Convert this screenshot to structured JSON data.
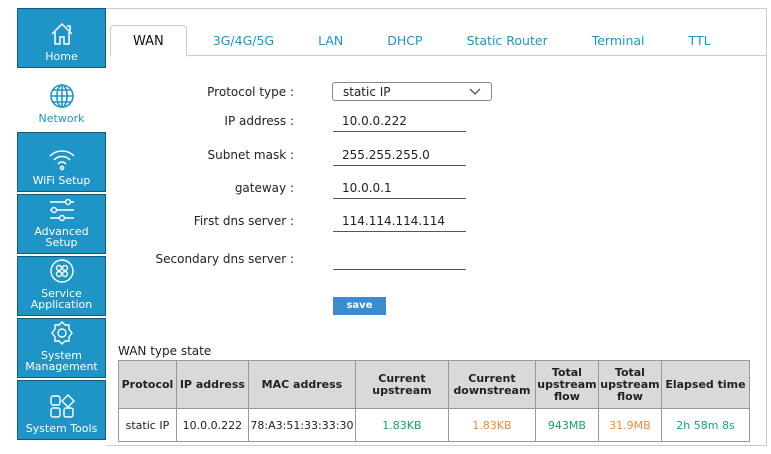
{
  "sidebar": {
    "items": [
      {
        "label": "Home",
        "icon": "home-icon"
      },
      {
        "label": "Network",
        "icon": "globe-icon",
        "active": true
      },
      {
        "label": "WiFi Setup",
        "icon": "wifi-icon"
      },
      {
        "label": "Advanced Setup",
        "icon": "sliders-icon"
      },
      {
        "label": "Service Application",
        "icon": "service-icon"
      },
      {
        "label": "System Management",
        "icon": "gear-icon"
      },
      {
        "label": "System Tools",
        "icon": "tools-grid-icon"
      }
    ]
  },
  "tabs": [
    "WAN",
    "3G/4G/5G",
    "LAN",
    "DHCP",
    "Static Router",
    "Terminal",
    "TTL"
  ],
  "form": {
    "protocol_label": "Protocol type :",
    "protocol_value": "static IP",
    "ip_label": "IP address :",
    "ip_value": "10.0.0.222",
    "mask_label": "Subnet mask :",
    "mask_value": "255.255.255.0",
    "gw_label": "gateway :",
    "gw_value": "10.0.0.1",
    "dns1_label": "First dns server  :",
    "dns1_value": "114.114.114.114",
    "dns2_label": "Secondary dns server  :",
    "dns2_value": "",
    "save": "save"
  },
  "state": {
    "title": "WAN type state",
    "headers": [
      "Protocol",
      "IP address",
      "MAC address",
      "Current upstream",
      "Current downstream",
      "Total upstream flow",
      "Total upstream flow",
      "Elapsed time"
    ],
    "row": [
      "static IP",
      "10.0.0.222",
      "78:A3:51:33:33:30",
      "1.83KB",
      "1.83KB",
      "943MB",
      "31.9MB",
      "2h 58m 8s"
    ],
    "colors": {
      "green": "#1aa35a",
      "orange": "#f08a3c",
      "teal": "#16a08a"
    }
  }
}
